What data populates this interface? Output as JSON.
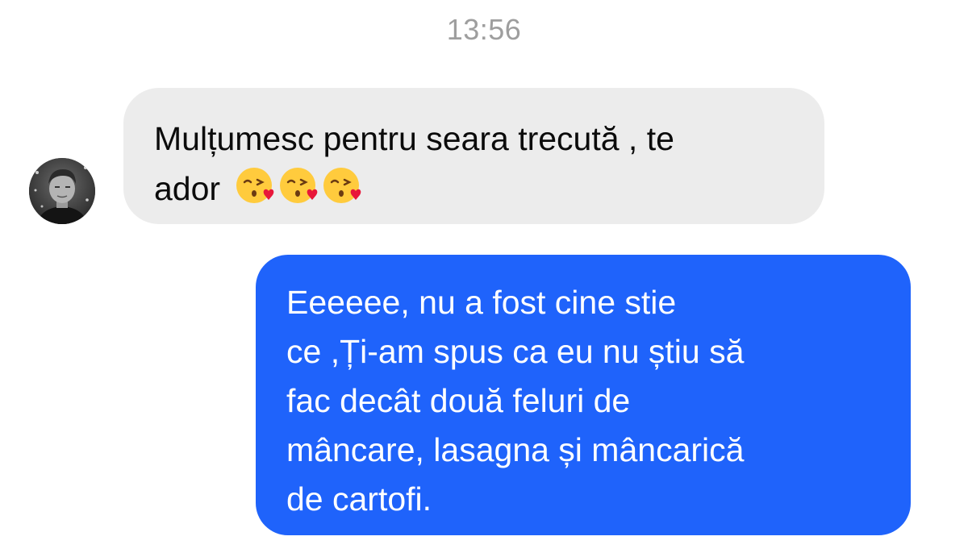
{
  "conversation": {
    "timestamp": "13:56",
    "incoming": {
      "text_line1": "Mulțumesc pentru seara trecută , te",
      "text_line2": "ador",
      "emojis": [
        "kissing-heart-emoji",
        "kissing-heart-emoji",
        "kissing-heart-emoji"
      ]
    },
    "outgoing": {
      "lines": [
        "Eeeeee, nu a fost cine stie",
        "ce ,Ți-am spus ca eu nu știu să",
        "fac decât două feluri de",
        "mâncare, lasagna și mâncarică",
        "de cartofi."
      ]
    }
  },
  "colors": {
    "incoming_bubble": "#ececec",
    "outgoing_bubble": "#1f63fb",
    "timestamp": "#9e9e9e"
  }
}
